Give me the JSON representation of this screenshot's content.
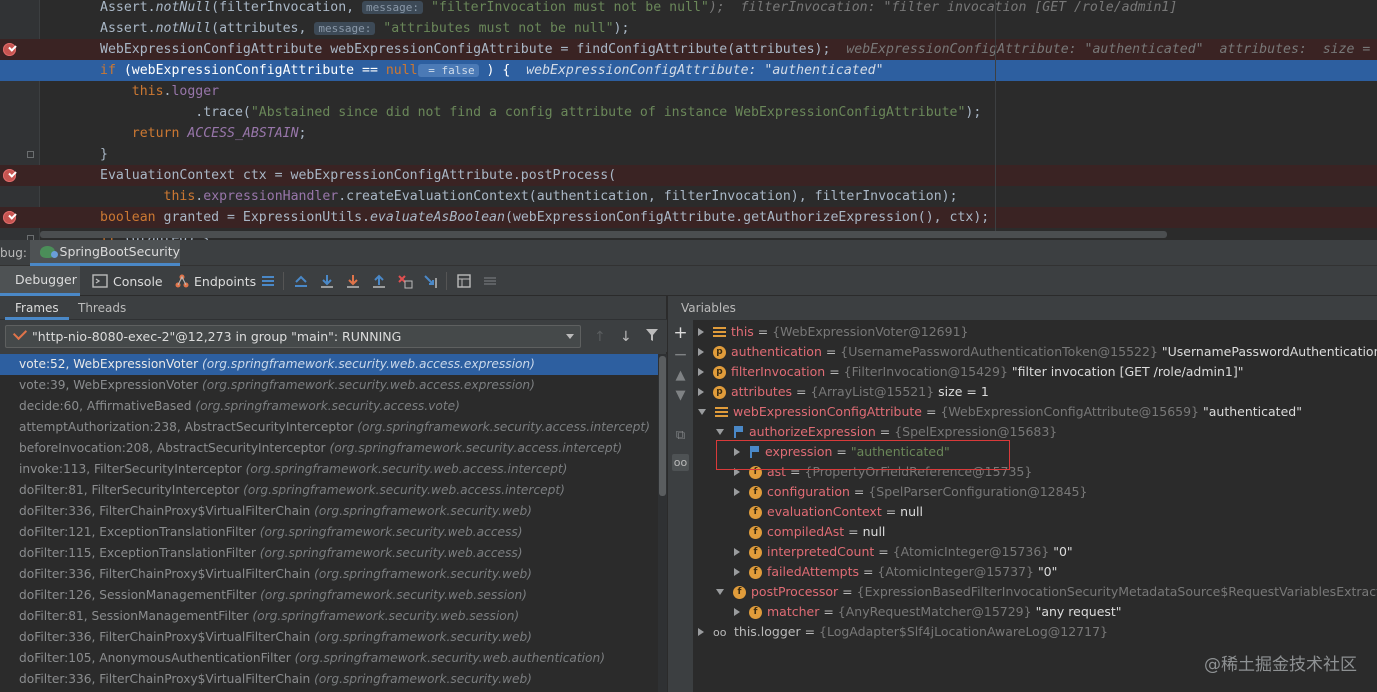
{
  "editor": {
    "lines": [
      {
        "parts": [
          {
            "t": "Assert.",
            "c": ""
          },
          {
            "t": "notNull",
            "c": "ital"
          },
          {
            "t": "(filterInvocation, ",
            "c": ""
          },
          {
            "t": "message:",
            "c": "pill"
          },
          {
            "t": " \"filterInvocation must not be null\"",
            "c": "str"
          },
          {
            "t": ");  filterInvocation: \"filter invocation [GET /role/admin1]",
            "c": "hint"
          }
        ],
        "bp": false,
        "exec": false
      },
      {
        "parts": [
          {
            "t": "Assert.",
            "c": ""
          },
          {
            "t": "notNull",
            "c": "ital"
          },
          {
            "t": "(attributes, ",
            "c": ""
          },
          {
            "t": "message:",
            "c": "pill"
          },
          {
            "t": " \"attributes must not be null\"",
            "c": "str"
          },
          {
            "t": ");",
            "c": ""
          }
        ],
        "bp": false,
        "exec": false
      },
      {
        "parts": [
          {
            "t": "WebExpressionConfigAttribute webExpressionConfigAttribute = findConfigAttribute(attributes);  ",
            "c": ""
          },
          {
            "t": "webExpressionConfigAttribute: \"authenticated\"  attributes:  size =",
            "c": "hint"
          }
        ],
        "bp": true,
        "exec": false
      },
      {
        "parts": [
          {
            "t": "if",
            "c": "kw"
          },
          {
            "t": " (webExpressionConfigAttribute == ",
            "c": ""
          },
          {
            "t": "null",
            "c": "kw"
          },
          {
            "t": " = false",
            "c": "pill"
          },
          {
            "t": " ) {  ",
            "c": ""
          },
          {
            "t": "webExpressionConfigAttribute: \"authenticated\"",
            "c": "hint"
          }
        ],
        "bp": false,
        "exec": true
      },
      {
        "parts": [
          {
            "t": "    ",
            "c": ""
          },
          {
            "t": "this",
            "c": "kw"
          },
          {
            "t": ".",
            "c": ""
          },
          {
            "t": "logger",
            "c": "fld"
          }
        ],
        "bp": false,
        "exec": false
      },
      {
        "parts": [
          {
            "t": "            .trace(",
            "c": ""
          },
          {
            "t": "\"Abstained since did not find a config attribute of instance WebExpressionConfigAttribute\"",
            "c": "str"
          },
          {
            "t": ");",
            "c": ""
          }
        ],
        "bp": false,
        "exec": false
      },
      {
        "parts": [
          {
            "t": "    ",
            "c": ""
          },
          {
            "t": "return",
            "c": "kw"
          },
          {
            "t": " ",
            "c": ""
          },
          {
            "t": "ACCESS_ABSTAIN",
            "c": "cst"
          },
          {
            "t": ";",
            "c": ""
          }
        ],
        "bp": false,
        "exec": false
      },
      {
        "parts": [
          {
            "t": "}",
            "c": ""
          }
        ],
        "bp": false,
        "exec": false
      },
      {
        "parts": [
          {
            "t": "EvaluationContext ctx = webExpressionConfigAttribute.postProcess(",
            "c": ""
          }
        ],
        "bp": true,
        "exec": false
      },
      {
        "parts": [
          {
            "t": "        ",
            "c": ""
          },
          {
            "t": "this",
            "c": "kw"
          },
          {
            "t": ".",
            "c": ""
          },
          {
            "t": "expressionHandler",
            "c": "fld"
          },
          {
            "t": ".createEvaluationContext(authentication, filterInvocation), filterInvocation);",
            "c": ""
          }
        ],
        "bp": false,
        "exec": false
      },
      {
        "parts": [
          {
            "t": "boolean",
            "c": "kw"
          },
          {
            "t": " granted = ExpressionUtils.",
            "c": ""
          },
          {
            "t": "evaluateAsBoolean",
            "c": "ital"
          },
          {
            "t": "(webExpressionConfigAttribute.getAuthorizeExpression(), ctx);",
            "c": ""
          }
        ],
        "bp": true,
        "exec": false
      },
      {
        "parts": [
          {
            "t": "if",
            "c": "kw"
          },
          {
            "t": " (granted) {",
            "c": ""
          }
        ],
        "bp": false,
        "exec": false
      }
    ]
  },
  "debug": {
    "label": "bug:",
    "session_tab": "SpringBootSecurity"
  },
  "toolbar": {
    "debugger": "Debugger",
    "console": "Console",
    "endpoints": "Endpoints"
  },
  "frames_panel": {
    "tabs": [
      "Frames",
      "Threads"
    ],
    "thread": "\"http-nio-8080-exec-2\"@12,273 in group \"main\": RUNNING",
    "frames": [
      {
        "method": "vote:52, WebExpressionVoter",
        "pkg": "(org.springframework.security.web.access.expression)"
      },
      {
        "method": "vote:39, WebExpressionVoter",
        "pkg": "(org.springframework.security.web.access.expression)"
      },
      {
        "method": "decide:60, AffirmativeBased",
        "pkg": "(org.springframework.security.access.vote)"
      },
      {
        "method": "attemptAuthorization:238, AbstractSecurityInterceptor",
        "pkg": "(org.springframework.security.access.intercept)"
      },
      {
        "method": "beforeInvocation:208, AbstractSecurityInterceptor",
        "pkg": "(org.springframework.security.access.intercept)"
      },
      {
        "method": "invoke:113, FilterSecurityInterceptor",
        "pkg": "(org.springframework.security.web.access.intercept)"
      },
      {
        "method": "doFilter:81, FilterSecurityInterceptor",
        "pkg": "(org.springframework.security.web.access.intercept)"
      },
      {
        "method": "doFilter:336, FilterChainProxy$VirtualFilterChain",
        "pkg": "(org.springframework.security.web)"
      },
      {
        "method": "doFilter:121, ExceptionTranslationFilter",
        "pkg": "(org.springframework.security.web.access)"
      },
      {
        "method": "doFilter:115, ExceptionTranslationFilter",
        "pkg": "(org.springframework.security.web.access)"
      },
      {
        "method": "doFilter:336, FilterChainProxy$VirtualFilterChain",
        "pkg": "(org.springframework.security.web)"
      },
      {
        "method": "doFilter:126, SessionManagementFilter",
        "pkg": "(org.springframework.security.web.session)"
      },
      {
        "method": "doFilter:81, SessionManagementFilter",
        "pkg": "(org.springframework.security.web.session)"
      },
      {
        "method": "doFilter:336, FilterChainProxy$VirtualFilterChain",
        "pkg": "(org.springframework.security.web)"
      },
      {
        "method": "doFilter:105, AnonymousAuthenticationFilter",
        "pkg": "(org.springframework.security.web.authentication)"
      },
      {
        "method": "doFilter:336, FilterChainProxy$VirtualFilterChain",
        "pkg": "(org.springframework.security.web)"
      }
    ]
  },
  "variables": {
    "title": "Variables",
    "rows": [
      {
        "indent": 0,
        "tw": "closed",
        "icon": "lines",
        "name": "this",
        "type": "{WebExpressionVoter@12691}",
        "val": "",
        "nameClass": "vn"
      },
      {
        "indent": 0,
        "tw": "closed",
        "icon": "p",
        "name": "authentication",
        "type": "{UsernamePasswordAuthenticationToken@15522}",
        "val": "\"UsernamePasswordAuthenticationToken [Pr",
        "nameClass": "vn"
      },
      {
        "indent": 0,
        "tw": "closed",
        "icon": "p",
        "name": "filterInvocation",
        "type": "{FilterInvocation@15429}",
        "val": "\"filter invocation [GET /role/admin1]\"",
        "nameClass": "vn"
      },
      {
        "indent": 0,
        "tw": "closed",
        "icon": "p",
        "name": "attributes",
        "type": "{ArrayList@15521}",
        "val": " size = 1",
        "nameClass": "vn"
      },
      {
        "indent": 0,
        "tw": "open",
        "icon": "lines",
        "name": "webExpressionConfigAttribute",
        "type": "{WebExpressionConfigAttribute@15659}",
        "val": "\"authenticated\"",
        "nameClass": "vn"
      },
      {
        "indent": 1,
        "tw": "open",
        "icon": "flag",
        "name": "authorizeExpression",
        "type": "{SpelExpression@15683}",
        "val": "",
        "nameClass": "vn"
      },
      {
        "indent": 2,
        "tw": "closed",
        "icon": "flag",
        "name": "expression",
        "type": "",
        "val": "\"authenticated\"",
        "nameClass": "vn",
        "valClass": "vstr"
      },
      {
        "indent": 2,
        "tw": "closed",
        "icon": "f",
        "name": "ast",
        "type": "{PropertyOrFieldReference@15735}",
        "val": "",
        "nameClass": "vn"
      },
      {
        "indent": 2,
        "tw": "closed",
        "icon": "f",
        "name": "configuration",
        "type": "{SpelParserConfiguration@12845}",
        "val": "",
        "nameClass": "vn"
      },
      {
        "indent": 2,
        "tw": "none",
        "icon": "f",
        "name": "evaluationContext",
        "type": "",
        "val": "null",
        "nameClass": "vn"
      },
      {
        "indent": 2,
        "tw": "none",
        "icon": "f",
        "name": "compiledAst",
        "type": "",
        "val": "null",
        "nameClass": "vn"
      },
      {
        "indent": 2,
        "tw": "closed",
        "icon": "f",
        "name": "interpretedCount",
        "type": "{AtomicInteger@15736}",
        "val": "\"0\"",
        "nameClass": "vn"
      },
      {
        "indent": 2,
        "tw": "closed",
        "icon": "f",
        "name": "failedAttempts",
        "type": "{AtomicInteger@15737}",
        "val": "\"0\"",
        "nameClass": "vn"
      },
      {
        "indent": 1,
        "tw": "open",
        "icon": "f",
        "name": "postProcessor",
        "type": "{ExpressionBasedFilterInvocationSecurityMetadataSource$RequestVariablesExtractorEvalua",
        "val": "",
        "nameClass": "vn"
      },
      {
        "indent": 2,
        "tw": "closed",
        "icon": "f",
        "name": "matcher",
        "type": "{AnyRequestMatcher@15729}",
        "val": "\"any request\"",
        "nameClass": "vn"
      },
      {
        "indent": 0,
        "tw": "closed",
        "icon": "glass",
        "name": "this.logger",
        "type": "{LogAdapter$Slf4jLocationAwareLog@12717}",
        "val": "",
        "nameClass": "vn this"
      }
    ]
  },
  "watermark": "@稀土掘金技术社区"
}
